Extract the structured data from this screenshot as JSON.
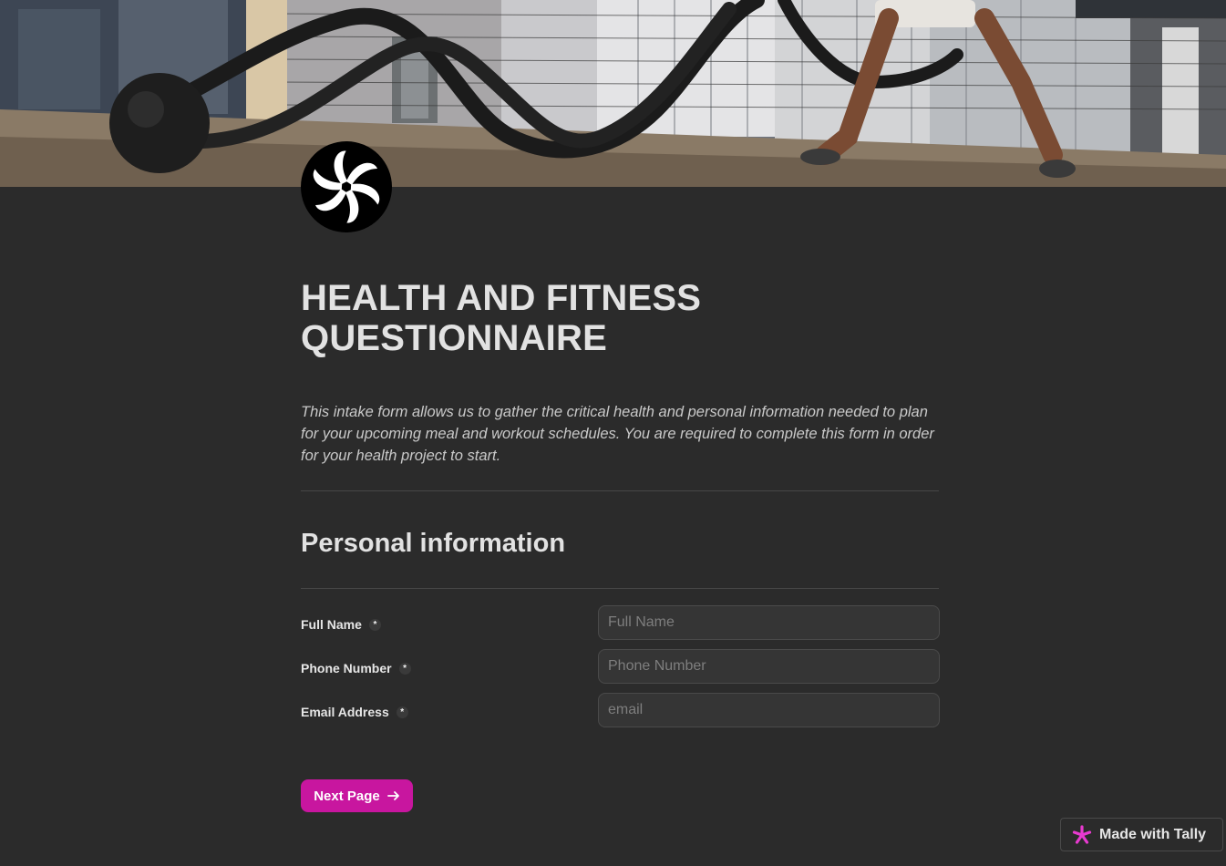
{
  "form": {
    "title": "HEALTH AND FITNESS QUESTIONNAIRE",
    "description": "This intake form allows us to gather the critical health and personal information needed to plan for your upcoming meal and workout schedules. You are required to complete this form in order for your health project to start.",
    "section_title": "Personal information",
    "fields": [
      {
        "label": "Full Name",
        "placeholder": "Full Name",
        "required_marker": "*"
      },
      {
        "label": "Phone Number",
        "placeholder": "Phone Number",
        "required_marker": "*"
      },
      {
        "label": "Email Address",
        "placeholder": "email",
        "required_marker": "*"
      }
    ],
    "next_button_label": "Next Page",
    "next_button_icon": "arrow-right-icon"
  },
  "badge": {
    "label": "Made with Tally",
    "icon": "tally-asterisk-icon"
  },
  "cover_image": {
    "icon": "battle-ropes-photo"
  },
  "logo": {
    "icon": "swirl-logo-icon"
  },
  "colors": {
    "background": "#2b2b2b",
    "accent": "#c8169f",
    "input_bg": "#353535",
    "text": "#e6e6e6"
  }
}
